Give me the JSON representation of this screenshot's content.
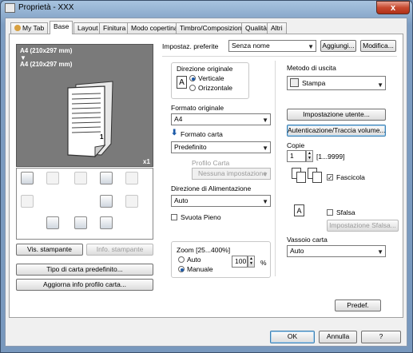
{
  "window": {
    "title": "Proprietà - XXX",
    "close_label": "x"
  },
  "tabs": [
    "My Tab",
    "Base",
    "Layout",
    "Finitura",
    "Modo copertina",
    "Timbro/Composizione",
    "Qualità",
    "Altri"
  ],
  "active_tab": "Base",
  "preview": {
    "line1": "A4 (210x297 mm)",
    "arrow": "▼",
    "line2": "A4 (210x297 mm)",
    "copies": "x1",
    "page_number": "1"
  },
  "left_buttons": {
    "printer_view": "Vis. stampante",
    "printer_info": "Info. stampante",
    "default_paper_type": "Tipo di carta predefinito...",
    "update_paper_profile": "Aggiorna info profilo carta..."
  },
  "favorites": {
    "label": "Impostaz. preferite",
    "value": "Senza nome",
    "add": "Aggiungi...",
    "modify": "Modifica..."
  },
  "orientation": {
    "label": "Direzione originale",
    "options": [
      "Verticale",
      "Orizzontale"
    ],
    "selected": "Verticale"
  },
  "original_size": {
    "label": "Formato originale",
    "value": "A4"
  },
  "paper_size": {
    "label": "Formato carta",
    "value": "Predefinito"
  },
  "paper_profile": {
    "label": "Profilo Carta",
    "value": "Nessuna impostazione"
  },
  "paper_feed": {
    "label": "Direzione di Alimentazione",
    "value": "Auto"
  },
  "empty_stack": {
    "label": "Svuota Pieno",
    "checked": false
  },
  "zoom": {
    "label": "Zoom [25...400%]",
    "options": [
      "Auto",
      "Manuale"
    ],
    "selected": "Manuale",
    "value": "100",
    "unit": "%"
  },
  "output_method": {
    "label": "Metodo di uscita",
    "value": "Stampa"
  },
  "user_settings_button": "Impostazione utente...",
  "auth_button": "Autenticazione/Traccia volume...",
  "copies": {
    "label": "Copie",
    "value": "1",
    "range": "[1...9999]",
    "collate_label": "Fascicola",
    "collate_checked": true
  },
  "offset": {
    "label": "Sfalsa",
    "checked": false,
    "settings_button": "Impostazione Sfalsa..."
  },
  "output_tray": {
    "label": "Vassoio carta",
    "value": "Auto"
  },
  "default_button": "Predef.",
  "dialog_buttons": {
    "ok": "OK",
    "cancel": "Annulla",
    "help": "?"
  },
  "colors": {
    "accent_blue": "#1c5aa8",
    "preview_gray": "#7a7a7a",
    "close_red": "#c84a30"
  }
}
